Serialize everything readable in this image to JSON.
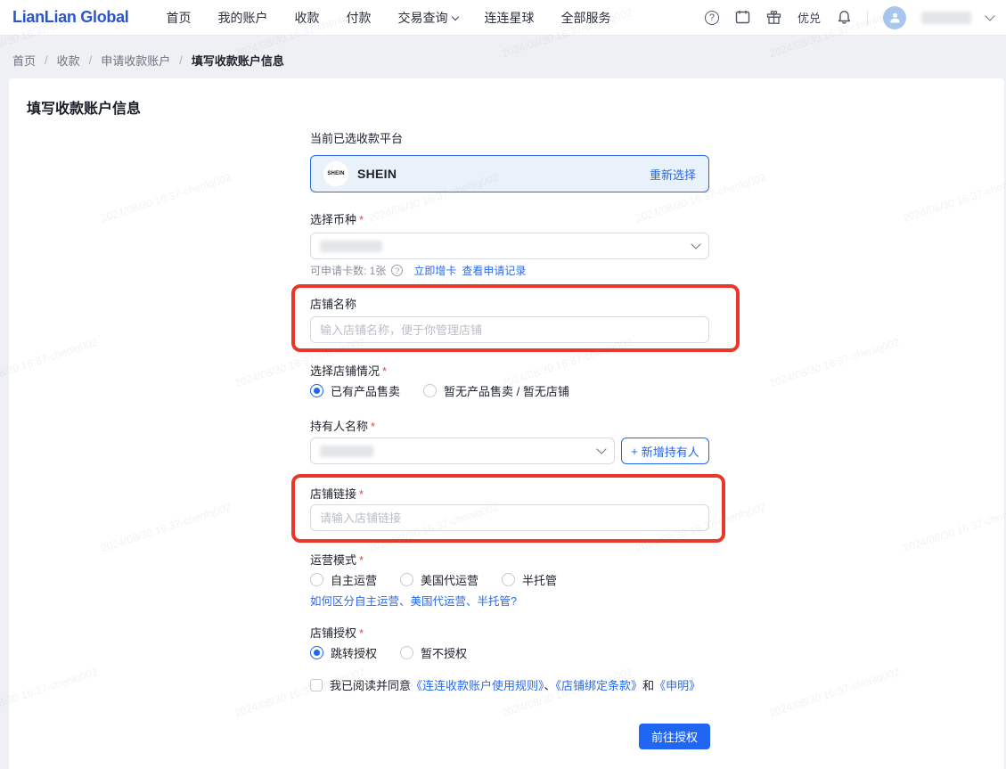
{
  "watermark": "2024/08/30 16:37-chenlq002",
  "icons": {
    "question_mark": "?"
  },
  "nav": {
    "logo": "LianLian Global",
    "items": [
      "首页",
      "我的账户",
      "收款",
      "付款",
      "交易查询",
      "连连星球",
      "全部服务"
    ],
    "youdui": "优兑"
  },
  "breadcrumb": {
    "items": [
      "首页",
      "收款",
      "申请收款账户"
    ],
    "separator": "/",
    "current": "填写收款账户信息"
  },
  "page": {
    "title": "填写收款账户信息"
  },
  "form": {
    "required_mark": "*",
    "platform": {
      "label": "当前已选收款平台",
      "logo_text": "SHEIN",
      "name": "SHEIN",
      "change_link": "重新选择"
    },
    "currency": {
      "label": "选择币种",
      "hint": "可申请卡数: 1张",
      "links": [
        "立即增卡",
        "查看申请记录"
      ]
    },
    "shop_name": {
      "label": "店铺名称",
      "placeholder": "输入店铺名称，便于你管理店铺",
      "value": ""
    },
    "shop_status": {
      "label": "选择店铺情况",
      "options": [
        "已有产品售卖",
        "暂无产品售卖 / 暂无店铺"
      ],
      "selected_index": 0
    },
    "holder": {
      "label": "持有人名称",
      "plus_icon": "+",
      "add_button_label": "新增持有人"
    },
    "shop_link": {
      "label": "店铺链接",
      "placeholder": "请输入店铺链接",
      "value": ""
    },
    "operation_mode": {
      "label": "运营模式",
      "options": [
        "自主运营",
        "美国代运营",
        "半托管"
      ],
      "selected_index": -1,
      "help_link": "如何区分自主运营、美国代运营、半托管?"
    },
    "authorization": {
      "label": "店铺授权",
      "options": [
        "跳转授权",
        "暂不授权"
      ],
      "selected_index": 0
    },
    "agreement": {
      "prefix": "我已阅读并同意",
      "link1": "《连连收款账户使用规则》",
      "sep1": "、",
      "link2": "《店铺绑定条款》",
      "sep2": "和",
      "link3": "《申明》"
    },
    "submit_label": "前往授权"
  },
  "colors": {
    "accent_blue": "#2166f3",
    "link_blue": "#2a6ae9",
    "highlight_red": "#ea372b",
    "platform_box_bg": "#e9f1fb",
    "platform_box_border": "#2e6be6",
    "required_red": "#f04134"
  }
}
